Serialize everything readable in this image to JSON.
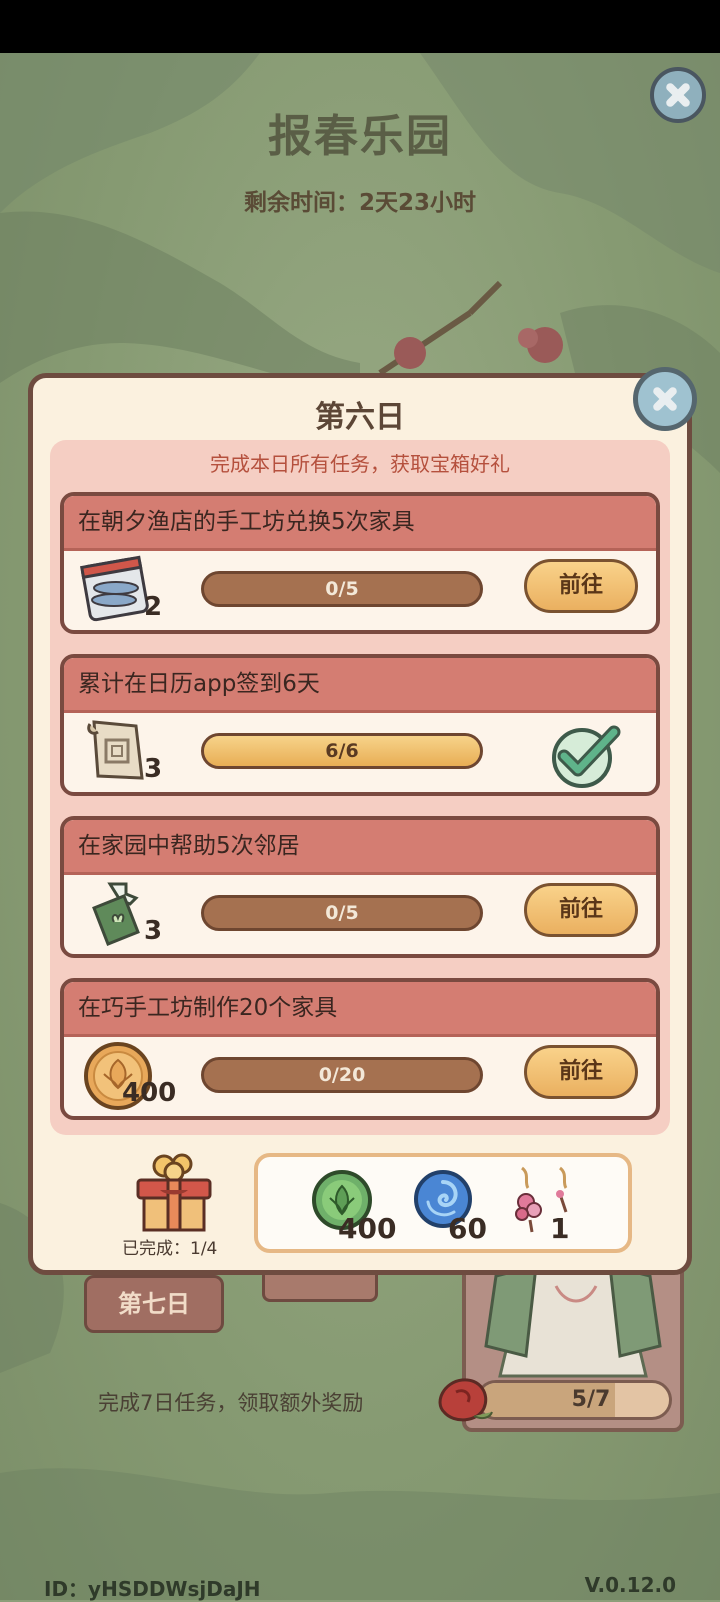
{
  "header": {
    "title": "报春乐园",
    "remaining": "剩余时间：2天23小时"
  },
  "dialog": {
    "title": "第六日",
    "subtitle": "完成本日所有任务，获取宝箱好礼",
    "tasks": [
      {
        "title": "在朝夕渔店的手工坊兑换5次家具",
        "reward_icon": "fish-basket-icon",
        "reward_count": "2",
        "progress_text": "0/5",
        "progress": 0,
        "action": "前往",
        "completed": false
      },
      {
        "title": "累计在日历app签到6天",
        "reward_icon": "scroll-icon",
        "reward_count": "3",
        "progress_text": "6/6",
        "progress": 1,
        "action": "",
        "completed": true
      },
      {
        "title": "在家园中帮助5次邻居",
        "reward_icon": "spray-bottle-icon",
        "reward_count": "3",
        "progress_text": "0/5",
        "progress": 0,
        "action": "前往",
        "completed": false
      },
      {
        "title": "在巧手工坊制作20个家具",
        "reward_icon": "gold-coin-icon",
        "reward_count": "400",
        "progress_text": "0/20",
        "progress": 0,
        "action": "前往",
        "completed": false
      }
    ],
    "chest": {
      "completed_label": "已完成：1/4"
    },
    "rewards": [
      {
        "icon": "green-leaf-coin-icon",
        "count": "400"
      },
      {
        "icon": "blue-swirl-orb-icon",
        "count": "60"
      },
      {
        "icon": "flower-earrings-icon",
        "count": "1"
      }
    ]
  },
  "background": {
    "day7_label": "第七日",
    "extra_reward_text": "完成7日任务，领取额外奖励",
    "dress_progress_text": "5/7",
    "dress_progress": 0.714
  },
  "footer": {
    "id": "ID：yHSDDWsjDaJH",
    "version": "V.0.12.0"
  },
  "colors": {
    "dialog_bg": "#fbf1df",
    "task_header": "#d47d72",
    "panel": "#f5cec3",
    "button": "#eab060",
    "background": "#8c9e79"
  }
}
